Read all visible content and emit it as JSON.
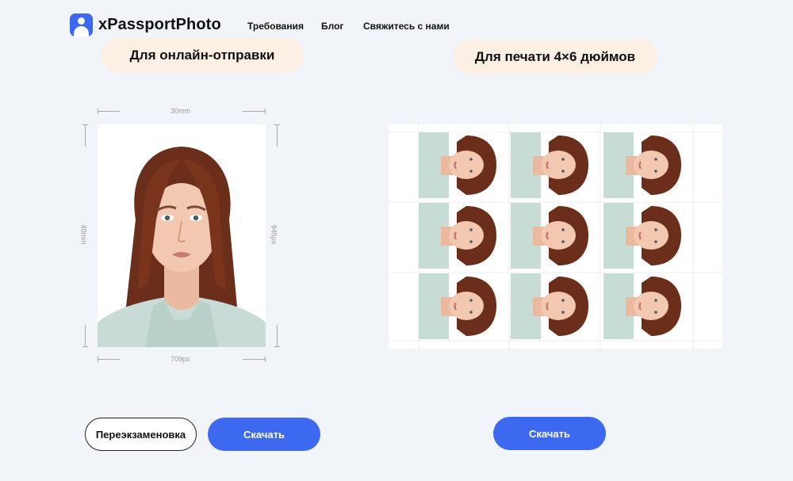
{
  "header": {
    "brand": "xPassportPhoto",
    "nav": [
      "Требования",
      "Блог",
      "Свяжитесь с нами"
    ]
  },
  "left": {
    "title": "Для онлайн-отправки",
    "dim_top": "30mm",
    "dim_bottom": "709px",
    "dim_left": "40mm",
    "dim_right": "945px"
  },
  "right": {
    "title": "Для печати 4×6 дюймов"
  },
  "buttons": {
    "retake": "Переэкзаменовка",
    "download_left": "Скачать",
    "download_right": "Скачать"
  },
  "colors": {
    "accent": "#3d68f0",
    "pill_bg": "#fcefe4",
    "page_bg": "#f1f5fa"
  }
}
